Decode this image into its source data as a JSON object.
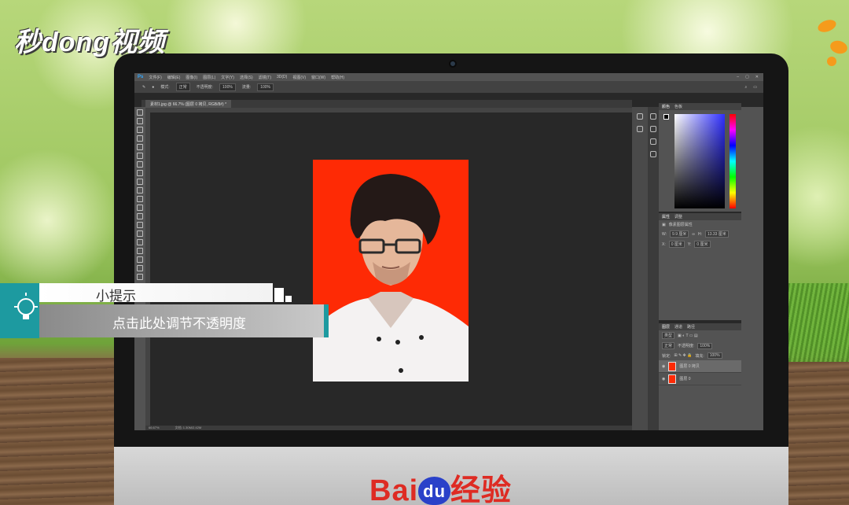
{
  "watermark": {
    "logo_text": "秒dong视频"
  },
  "photoshop": {
    "menu": [
      "文件(F)",
      "编辑(E)",
      "图像(I)",
      "图层(L)",
      "文字(Y)",
      "选择(S)",
      "滤镜(T)",
      "3D(D)",
      "视图(V)",
      "窗口(W)",
      "帮助(H)"
    ],
    "options": {
      "mode_label": "模式:",
      "mode_value": "正常",
      "opacity_label": "不透明度:",
      "opacity_value": "100%",
      "flow_label": "流量:",
      "flow_value": "100%"
    },
    "doc_tab": "素材1.jpg @ 66.7% (图层 0 拷贝, RGB/8#) *",
    "status": {
      "zoom": "66.67%",
      "doc": "文档: 1.30M/2.42M"
    },
    "color_panel": {
      "tabs": [
        "颜色",
        "色板"
      ]
    },
    "properties_panel": {
      "tabs": [
        "属性",
        "调整"
      ],
      "title": "像素图层属性",
      "w_label": "W:",
      "w_value": "9.9 厘米",
      "h_label": "H:",
      "h_value": "13.33 厘米",
      "x_label": "X:",
      "x_value": "0 厘米",
      "y_label": "Y:",
      "y_value": "0 厘米"
    },
    "layers_panel": {
      "tabs": [
        "图层",
        "通道",
        "路径"
      ],
      "kind": "类型",
      "blend": "正常",
      "opacity_label": "不透明度:",
      "opacity_value": "100%",
      "lock_label": "锁定:",
      "fill_label": "填充:",
      "fill_value": "100%",
      "layers": [
        {
          "name": "图层 0 拷贝",
          "selected": true
        },
        {
          "name": "图层 0",
          "selected": false
        }
      ]
    }
  },
  "tip": {
    "title": "小提示",
    "body": "点击此处调节不透明度"
  },
  "brand": {
    "prefix": "Bai",
    "du": "du",
    "suffix": "经验"
  }
}
